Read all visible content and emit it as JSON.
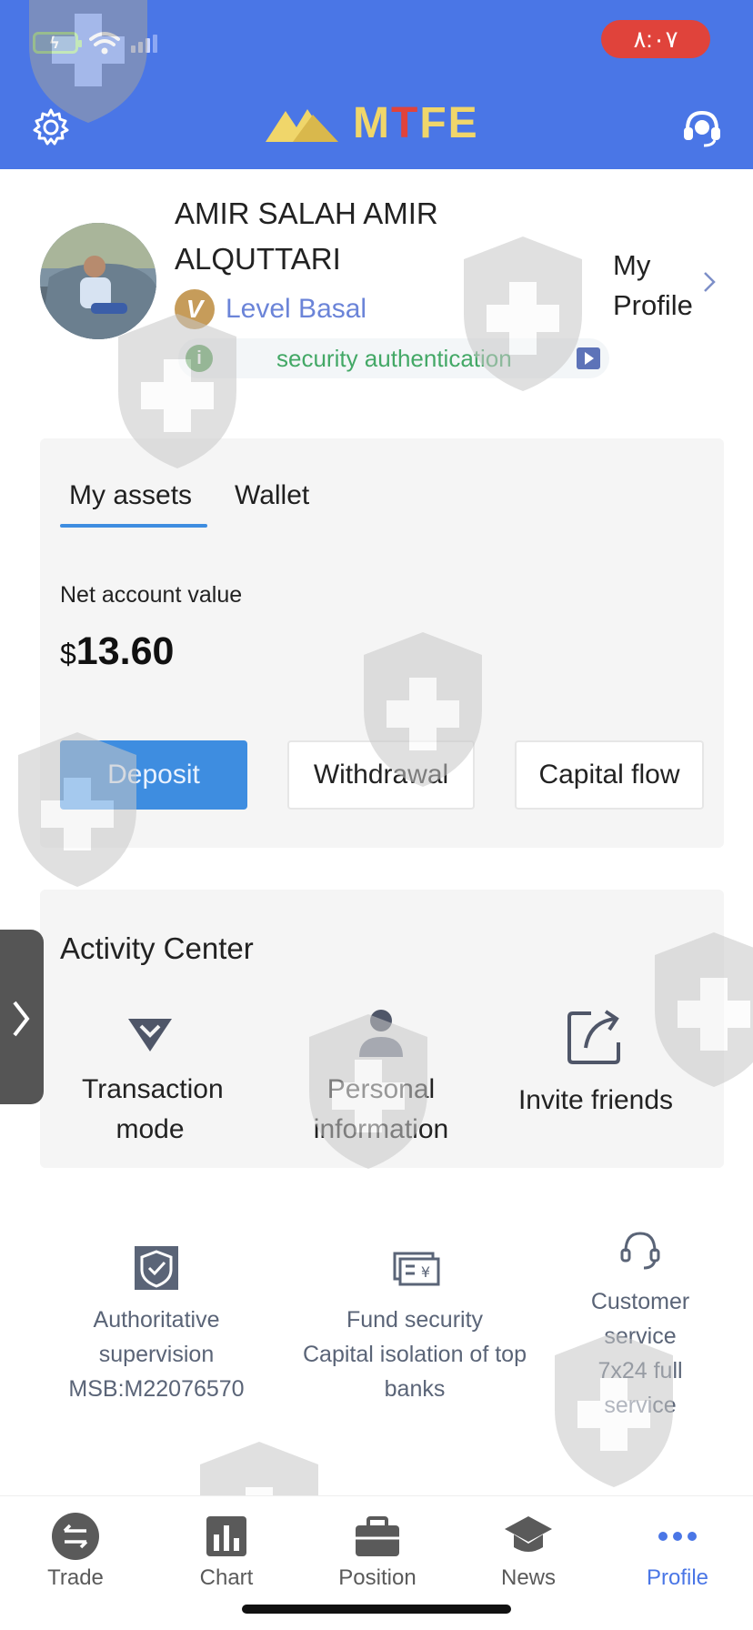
{
  "status_bar": {
    "time": "٨:٠٧"
  },
  "header": {
    "logo_text_m": "M",
    "logo_text_t": "T",
    "logo_text_fe": "FE"
  },
  "profile": {
    "name": "AMIR SALAH AMIR ALQUTTARI",
    "level_badge": "V",
    "level": "Level Basal",
    "security_info_icon": "i",
    "security_text": "security authentication",
    "my_profile_label": "My Profile"
  },
  "assets": {
    "tabs": [
      {
        "label": "My assets",
        "active": true
      },
      {
        "label": "Wallet",
        "active": false
      }
    ],
    "net_label": "Net account value",
    "currency": "$",
    "net_value": "13.60",
    "buttons": {
      "deposit": "Deposit",
      "withdrawal": "Withdrawal",
      "capital_flow": "Capital flow"
    }
  },
  "activity": {
    "title": "Activity Center",
    "items": [
      {
        "label": "Transaction mode",
        "icon": "diamond-icon"
      },
      {
        "label": "Personal information",
        "icon": "user-icon"
      },
      {
        "label": "Invite friends",
        "icon": "share-icon"
      }
    ]
  },
  "features": [
    {
      "icon": "shield-check-icon",
      "lines": [
        "Authoritative",
        "supervision",
        "MSB:M22076570"
      ]
    },
    {
      "icon": "banknote-icon",
      "lines": [
        "Fund security",
        "Capital isolation of top",
        "banks"
      ]
    },
    {
      "icon": "headset-icon",
      "lines": [
        "Customer",
        "service",
        "7x24 full",
        "service"
      ]
    }
  ],
  "bottom_nav": [
    {
      "label": "Trade",
      "icon": "exchange-icon",
      "active": false
    },
    {
      "label": "Chart",
      "icon": "chart-icon",
      "active": false
    },
    {
      "label": "Position",
      "icon": "briefcase-icon",
      "active": false
    },
    {
      "label": "News",
      "icon": "graduation-cap-icon",
      "active": false
    },
    {
      "label": "Profile",
      "icon": "more-dots-icon",
      "active": true
    }
  ],
  "colors": {
    "header_bg": "#4a76e6",
    "accent_blue": "#3e8de0",
    "security_green": "#43a866",
    "level_gold": "#c69c5a",
    "time_pill_red": "#e0433b",
    "active_nav": "#4a76e6"
  }
}
